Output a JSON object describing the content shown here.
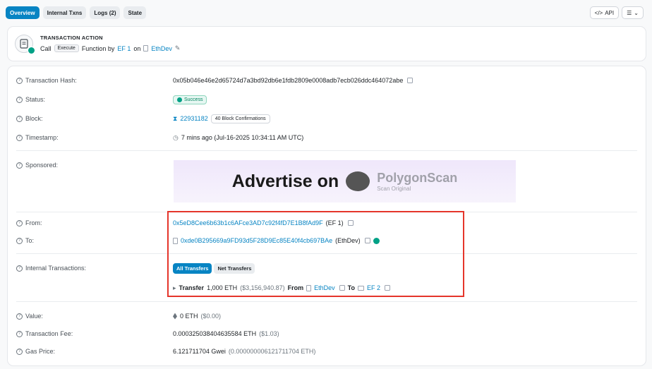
{
  "tabs": [
    "Overview",
    "Internal Txns",
    "Logs (2)",
    "State"
  ],
  "toolbar": {
    "api_label": "API"
  },
  "tx_action": {
    "title": "TRANSACTION ACTION",
    "call": "Call",
    "method": "Execute",
    "function_by": "Function by",
    "from_name": "EF 1",
    "on": "on",
    "contract": "EthDev"
  },
  "details": {
    "hash": {
      "label": "Transaction Hash:",
      "value": "0x05b046e46e2d65724d7a3bd92db6e1fdb2809e0008adb7ecb026ddc464072abe"
    },
    "status": {
      "label": "Status:",
      "value": "Success"
    },
    "block": {
      "label": "Block:",
      "value": "22931182",
      "confirmations": "40 Block Confirmations"
    },
    "timestamp": {
      "label": "Timestamp:",
      "value": "7 mins ago (Jul-16-2025 10:34:11 AM UTC)"
    },
    "sponsored": {
      "label": "Sponsored:",
      "ad_text": "Advertise on",
      "ad_brand": "PolygonScan",
      "ad_sub": "Scan Original"
    },
    "from": {
      "label": "From:",
      "address": "0x5eD8Cee6b63b1c6AFce3AD7c92f4fD7E1B8fAd9F",
      "name": "(EF 1)"
    },
    "to": {
      "label": "To:",
      "address": "0xde0B295669a9FD93d5F28D9Ec85E40f4cb697BAe",
      "name": "(EthDev)"
    },
    "internal": {
      "label": "Internal Transactions:",
      "tab_all": "All Transfers",
      "tab_net": "Net Transfers",
      "transfer_word": "Transfer",
      "amount": "1,000 ETH",
      "usd": "($3,156,940.87)",
      "from_word": "From",
      "from_name": "EthDev",
      "to_word": "To",
      "to_name": "EF 2"
    },
    "value": {
      "label": "Value:",
      "eth": "0 ETH",
      "usd": "($0.00)"
    },
    "fee": {
      "label": "Transaction Fee:",
      "eth": "0.000325038404635584 ETH",
      "usd": "($1.03)"
    },
    "gas": {
      "label": "Gas Price:",
      "gwei": "6.121711704 Gwei",
      "eth": "(0.000000006121711704 ETH)"
    }
  }
}
